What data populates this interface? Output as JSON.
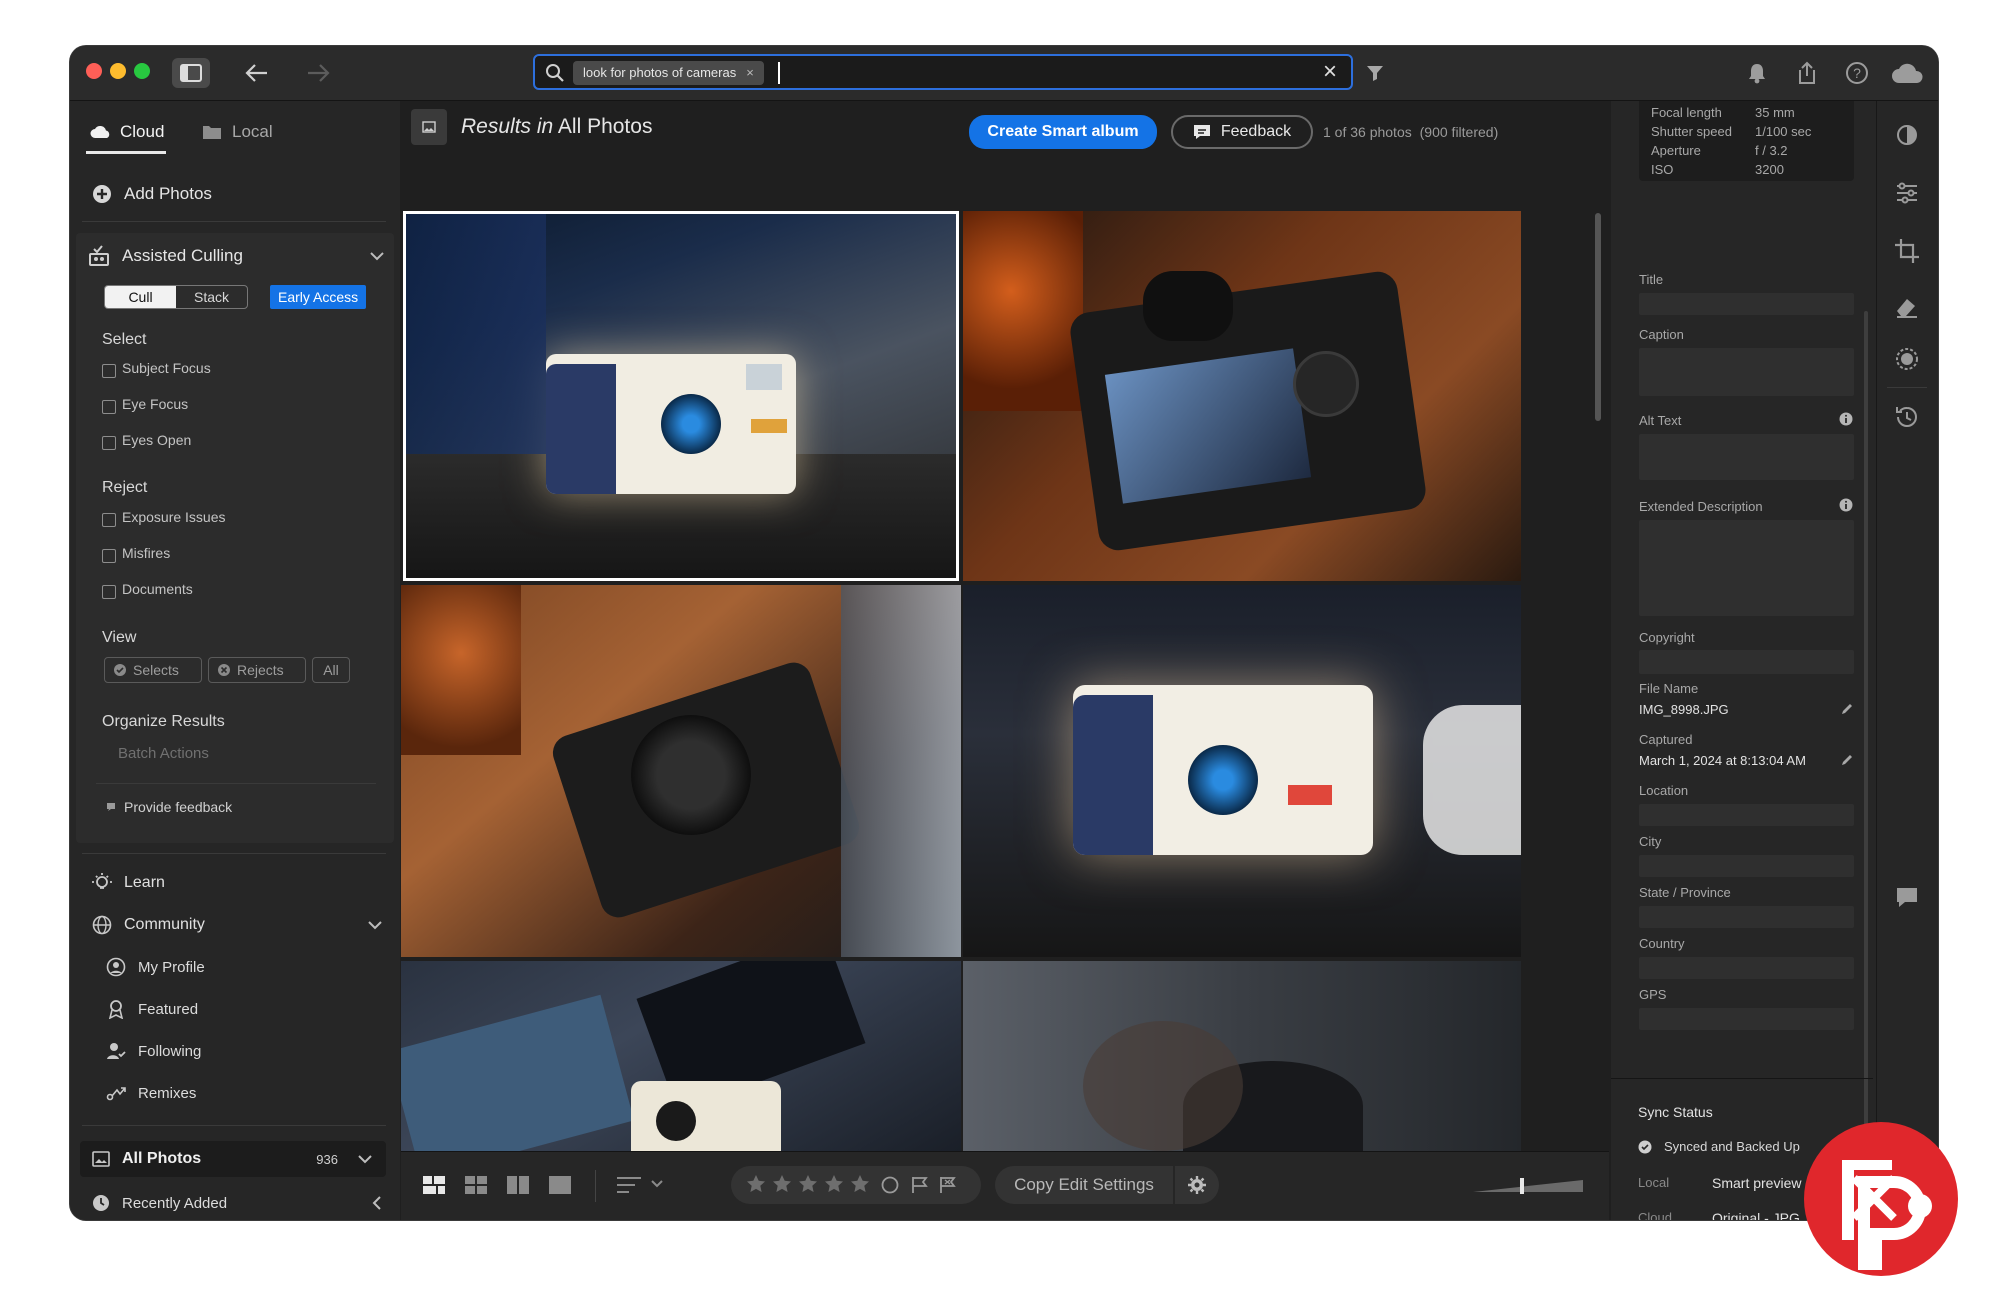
{
  "search": {
    "chip": "look for photos of cameras",
    "chip_close": "×",
    "clear": "×"
  },
  "left": {
    "tab_cloud": "Cloud",
    "tab_local": "Local",
    "add_photos": "Add Photos",
    "culling": {
      "title": "Assisted Culling",
      "seg_cull": "Cull",
      "seg_stack": "Stack",
      "early_access": "Early Access",
      "select_heading": "Select",
      "select_items": [
        "Subject Focus",
        "Eye Focus",
        "Eyes Open"
      ],
      "reject_heading": "Reject",
      "reject_items": [
        "Exposure Issues",
        "Misfires",
        "Documents"
      ],
      "view_heading": "View",
      "view_selects": "Selects",
      "view_rejects": "Rejects",
      "view_all": "All",
      "organize_heading": "Organize Results",
      "batch_actions": "Batch Actions",
      "provide_feedback": "Provide feedback"
    },
    "learn": "Learn",
    "community": "Community",
    "community_items": [
      "My Profile",
      "Featured",
      "Following",
      "Remixes"
    ],
    "all_photos": "All Photos",
    "all_photos_count": "936",
    "recently_added": "Recently Added"
  },
  "center": {
    "results_prefix": "Results in",
    "results_scope": "All Photos",
    "create_smart_album": "Create Smart album",
    "feedback": "Feedback",
    "count_text": "1 of 36 photos",
    "filtered_text": "(900 filtered)"
  },
  "bottom": {
    "rating": 0,
    "rating_max": 5,
    "copy_edit_settings": "Copy Edit Settings"
  },
  "right": {
    "exif": [
      {
        "label": "Focal length",
        "value": "35 mm"
      },
      {
        "label": "Shutter speed",
        "value": "1/100 sec"
      },
      {
        "label": "Aperture",
        "value": "f / 3.2"
      },
      {
        "label": "ISO",
        "value": "3200"
      }
    ],
    "title_label": "Title",
    "caption_label": "Caption",
    "alt_text_label": "Alt Text",
    "extended_description_label": "Extended Description",
    "copyright_label": "Copyright",
    "file_name_label": "File Name",
    "file_name": "IMG_8998.JPG",
    "captured_label": "Captured",
    "captured": "March 1, 2024 at 8:13:04 AM",
    "location_label": "Location",
    "city_label": "City",
    "state_label": "State / Province",
    "country_label": "Country",
    "gps_label": "GPS",
    "sync_title": "Sync Status",
    "sync_state": "Synced and Backed Up",
    "local_label": "Local",
    "local_value": "Smart preview",
    "cloud_label": "Cloud",
    "cloud_value": "Original - JPG"
  },
  "colors": {
    "accent": "#1473e6",
    "watermark_red": "#e0272c",
    "panel_bg": "#262626",
    "grid_bg": "#1f1f1f"
  }
}
